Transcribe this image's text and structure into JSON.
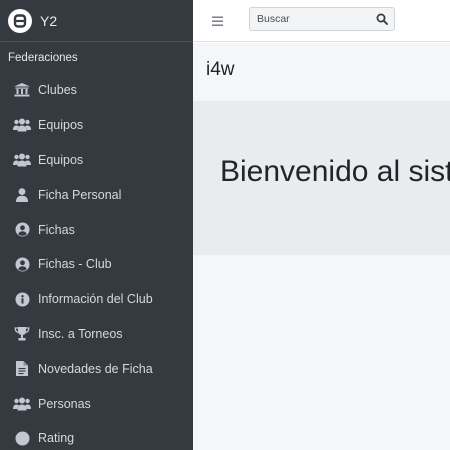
{
  "brand": {
    "name": "Y2"
  },
  "sidebar": {
    "section_header": "Federaciones",
    "items": [
      {
        "label": "Clubes",
        "icon": "landmark-icon"
      },
      {
        "label": "Equipos",
        "icon": "users-icon"
      },
      {
        "label": "Equipos",
        "icon": "users-icon"
      },
      {
        "label": "Ficha Personal",
        "icon": "user-icon"
      },
      {
        "label": "Fichas",
        "icon": "user-circle-icon"
      },
      {
        "label": "Fichas - Club",
        "icon": "user-circle-icon"
      },
      {
        "label": "Información del Club",
        "icon": "info-circle-icon"
      },
      {
        "label": "Insc. a Torneos",
        "icon": "trophy-icon"
      },
      {
        "label": "Novedades de Ficha",
        "icon": "file-icon"
      },
      {
        "label": "Personas",
        "icon": "users-icon"
      },
      {
        "label": "Rating",
        "icon": "circle-icon"
      }
    ]
  },
  "topbar": {
    "search_placeholder": "Buscar"
  },
  "main": {
    "title": "i4w",
    "welcome": "Bienvenido al sistema"
  },
  "colors": {
    "sidebar_bg": "#343a40",
    "content_bg": "#f4f6f9",
    "jumbotron_bg": "#e9ecef"
  }
}
